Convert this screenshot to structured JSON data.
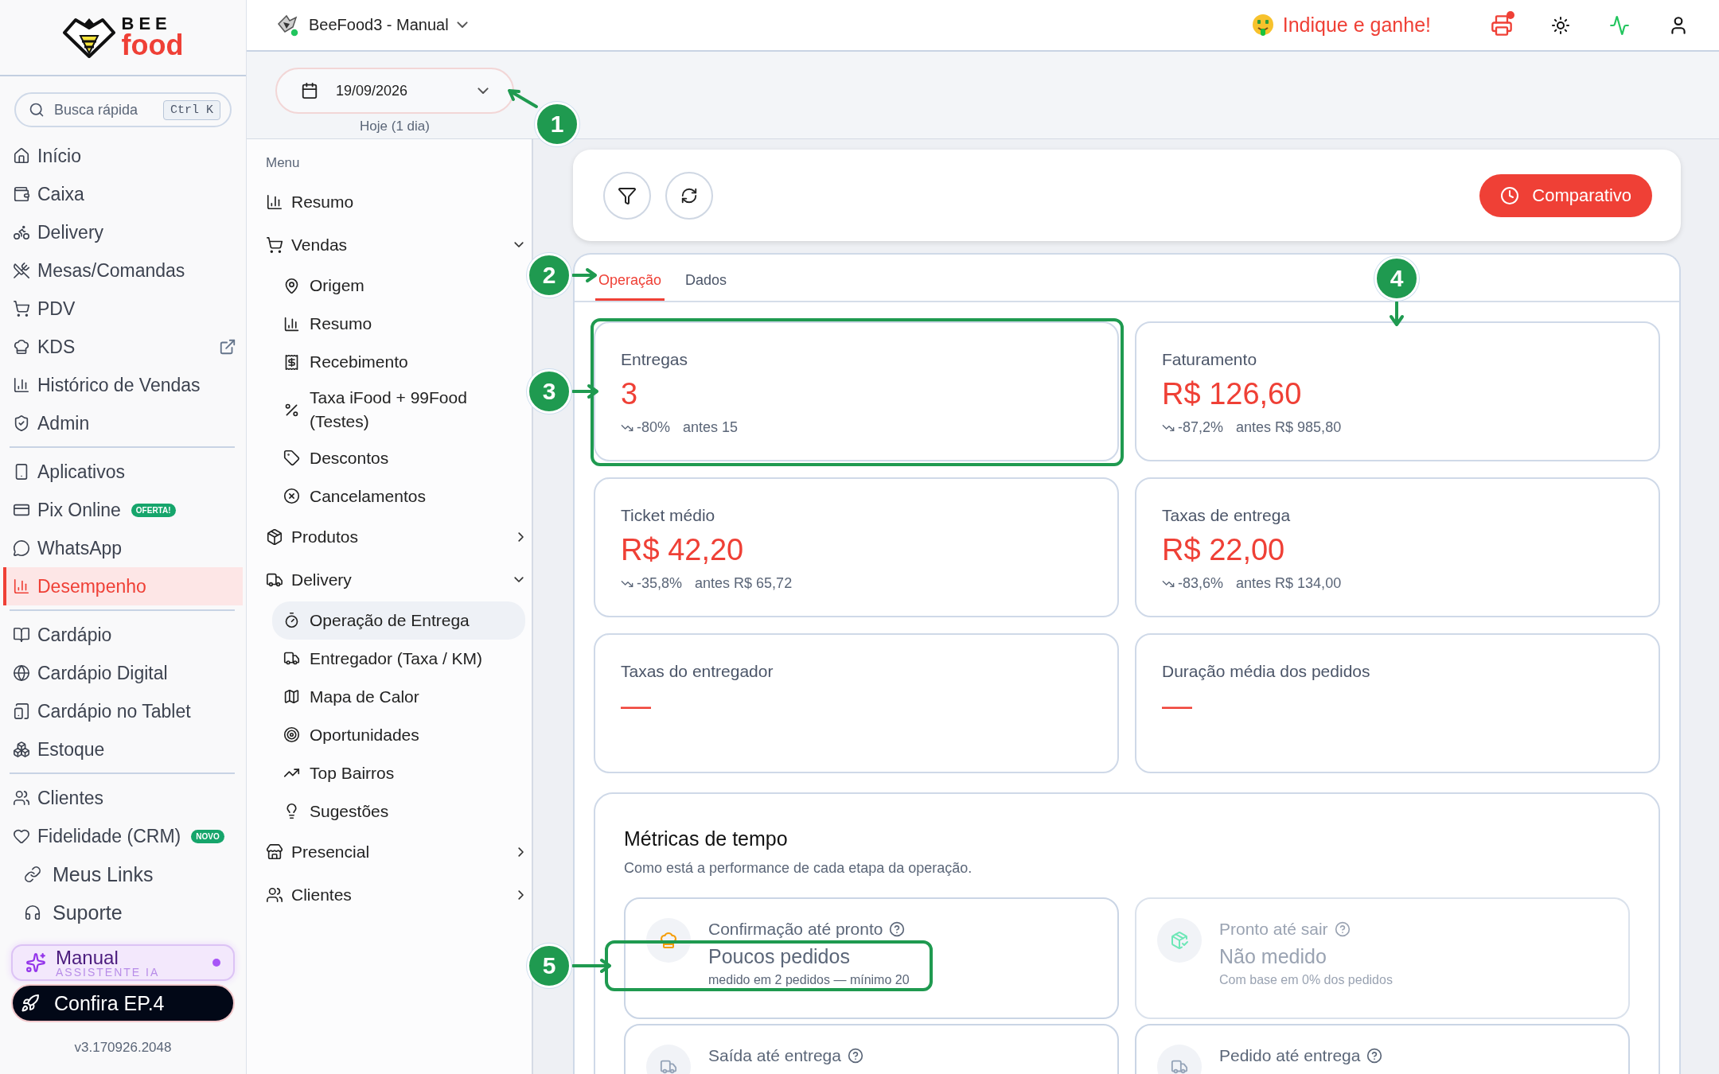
{
  "logo": {
    "top": "BEE",
    "bottom": "food"
  },
  "search": {
    "placeholder": "Busca rápida",
    "shortcut": "Ctrl K"
  },
  "nav_groups": [
    {
      "items": [
        {
          "label": "Início",
          "selected": false
        },
        {
          "label": "Caixa",
          "selected": false
        },
        {
          "label": "Delivery",
          "selected": false
        },
        {
          "label": "Mesas/Comandas",
          "selected": false
        },
        {
          "label": "PDV",
          "selected": false
        },
        {
          "label": "KDS",
          "selected": false,
          "external": true
        },
        {
          "label": "Histórico de Vendas",
          "selected": false
        },
        {
          "label": "Admin",
          "selected": false
        }
      ]
    },
    {
      "items": [
        {
          "label": "Aplicativos",
          "selected": false
        },
        {
          "label": "Pix Online",
          "selected": false,
          "badge": "OFERTA!"
        },
        {
          "label": "WhatsApp",
          "selected": false
        },
        {
          "label": "Desempenho",
          "selected": true
        }
      ]
    },
    {
      "items": [
        {
          "label": "Cardápio",
          "selected": false
        },
        {
          "label": "Cardápio Digital",
          "selected": false
        },
        {
          "label": "Cardápio no Tablet",
          "selected": false
        },
        {
          "label": "Estoque",
          "selected": false
        }
      ]
    },
    {
      "items": [
        {
          "label": "Clientes",
          "selected": false
        },
        {
          "label": "Fidelidade (CRM)",
          "selected": false,
          "badge": "NOVO"
        }
      ]
    }
  ],
  "footer_links": [
    {
      "label": "Meus Links"
    },
    {
      "label": "Suporte"
    }
  ],
  "assistant": {
    "title": "Manual",
    "subtitle": "ASSISTENTE IA"
  },
  "promo": "Confira EP.4",
  "version": "v3.170926.2048",
  "header": {
    "workspace": "BeeFood3 - Manual",
    "referral": "Indique e ganhe!"
  },
  "date_filter": {
    "value": "19/09/2026",
    "caption": "Hoje (1 dia)"
  },
  "submenu": {
    "title": "Menu",
    "items": [
      {
        "label": "Resumo",
        "selected": false
      },
      {
        "label": "Vendas",
        "selected": false,
        "expanded": true,
        "children": [
          {
            "label": "Origem",
            "selected": false
          },
          {
            "label": "Resumo",
            "selected": false
          },
          {
            "label": "Recebimento",
            "selected": false
          },
          {
            "label": "Taxa iFood + 99Food (Testes)",
            "selected": false
          },
          {
            "label": "Descontos",
            "selected": false
          },
          {
            "label": "Cancelamentos",
            "selected": false
          }
        ]
      },
      {
        "label": "Produtos",
        "selected": false,
        "expanded": false
      },
      {
        "label": "Delivery",
        "selected": false,
        "expanded": true,
        "children": [
          {
            "label": "Operação de Entrega",
            "selected": true
          },
          {
            "label": "Entregador (Taxa / KM)",
            "selected": false
          },
          {
            "label": "Mapa de Calor",
            "selected": false
          },
          {
            "label": "Oportunidades",
            "selected": false
          },
          {
            "label": "Top Bairros",
            "selected": false
          },
          {
            "label": "Sugestões",
            "selected": false
          }
        ]
      },
      {
        "label": "Presencial",
        "selected": false,
        "expanded": false
      },
      {
        "label": "Clientes",
        "selected": false,
        "expanded": false
      }
    ]
  },
  "toolbar": {
    "compare_button": "Comparativo"
  },
  "tabs": [
    {
      "label": "Operação",
      "selected": true
    },
    {
      "label": "Dados",
      "selected": false
    }
  ],
  "metrics": [
    {
      "label": "Entregas",
      "value": "3",
      "trend": {
        "change": "-80%",
        "before": "antes 15"
      }
    },
    {
      "label": "Faturamento",
      "value": "R$ 126,60",
      "trend": {
        "change": "-87,2%",
        "before": "antes R$ 985,80"
      }
    },
    {
      "label": "Ticket médio",
      "value": "R$ 42,20",
      "trend": {
        "change": "-35,8%",
        "before": "antes R$ 65,72"
      }
    },
    {
      "label": "Taxas de entrega",
      "value": "R$ 22,00",
      "trend": {
        "change": "-83,6%",
        "before": "antes R$ 134,00"
      }
    },
    {
      "label": "Taxas do entregador",
      "value": "—"
    },
    {
      "label": "Duração média dos pedidos",
      "value": "—"
    }
  ],
  "time_metrics": {
    "title": "Métricas de tempo",
    "subtitle": "Como está a performance de cada etapa da operação.",
    "items": [
      {
        "title": "Confirmação até pronto",
        "value": "Poucos pedidos",
        "note": "medido em 2 pedidos — mínimo 20",
        "disabled": false
      },
      {
        "title": "Pronto até sair",
        "value": "Não medido",
        "note": "Com base em 0% dos pedidos",
        "disabled": true
      },
      {
        "title": "Saída até entrega",
        "disabled": false
      },
      {
        "title": "Pedido até entrega",
        "disabled": false
      }
    ]
  },
  "annotations": [
    {
      "number": "1"
    },
    {
      "number": "2"
    },
    {
      "number": "4"
    },
    {
      "number": "3"
    },
    {
      "number": "5"
    }
  ]
}
